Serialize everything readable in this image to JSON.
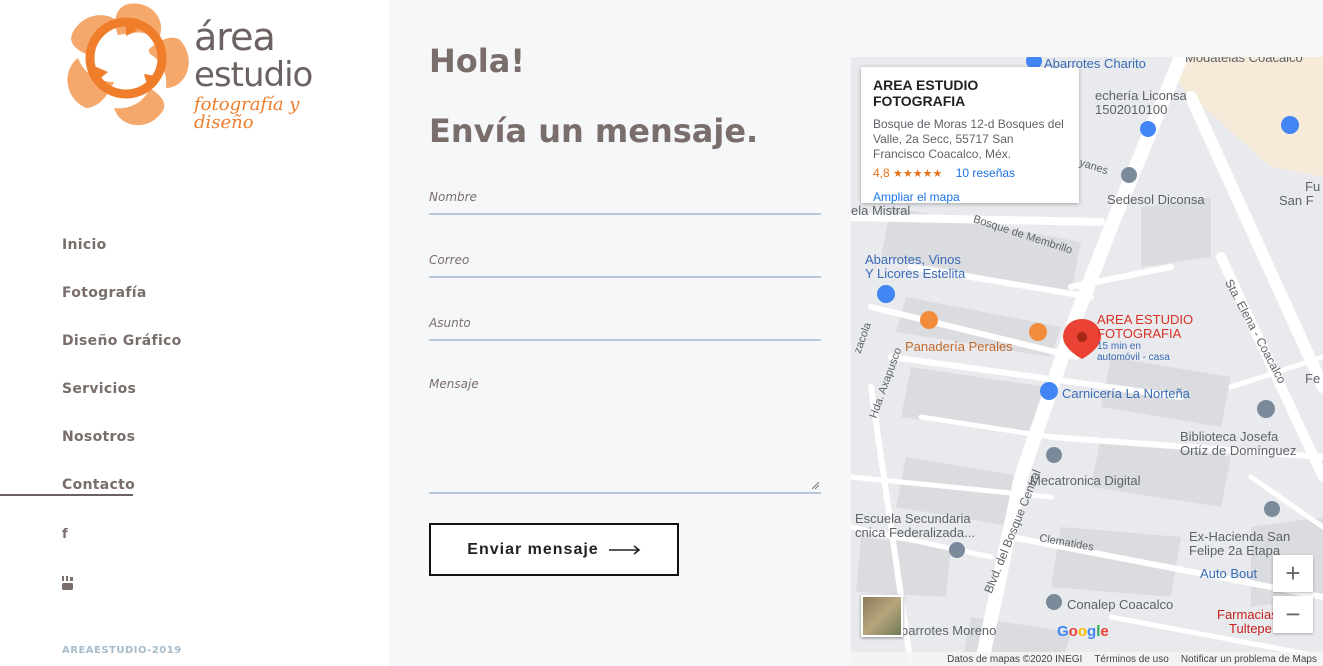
{
  "brand": {
    "word1": "área",
    "word2": "estudio",
    "tagline": "fotografía y diseño",
    "colors": {
      "orange": "#ef7d2a",
      "gray": "#6b6261"
    }
  },
  "nav": {
    "items": [
      {
        "label": "Inicio"
      },
      {
        "label": "Fotografía"
      },
      {
        "label": "Diseño Gráfico"
      },
      {
        "label": "Servicios"
      },
      {
        "label": "Nosotros"
      },
      {
        "label": "Contacto",
        "active": true
      }
    ]
  },
  "social": {
    "facebook": "f",
    "youtube_icon": "youtube-icon"
  },
  "footer": {
    "copyright": "AREAESTUDIO-2019"
  },
  "form": {
    "greeting": "Hola!",
    "heading": "Envía un mensaje.",
    "fields": {
      "name": "Nombre",
      "email": "Correo",
      "subject": "Asunto",
      "message": "Mensaje"
    },
    "submit": "Enviar mensaje"
  },
  "map": {
    "card": {
      "title": "AREA ESTUDIO FOTOGRAFIA",
      "address": "Bosque de Moras 12-d Bosques del Valle, 2a Secc, 55717 San Francisco Coacalco, Méx.",
      "rating": "4,8",
      "stars": "★★★★★",
      "reviews": "10 reseñas",
      "enlarge": "Ampliar el mapa"
    },
    "labels": {
      "abarrotes_charito": "Abarrotes Charito",
      "modatelas": "Modatelas Coacalco",
      "lecheria1": "echería Liconsa",
      "lecheria2": "1502010100",
      "ayanes": "yanes",
      "sedesol": "Sedesol Diconsa",
      "mistral": "ela Mistral",
      "membrillo": "Bosque de Membrillo",
      "abarrotes_vinos1": "Abarrotes, Vinos",
      "abarrotes_vinos2": "Y Licores Estelita",
      "panaderia": "Panadería Perales",
      "pin_name1": "AREA ESTUDIO",
      "pin_name2": "FOTOGRAFIA",
      "pin_sub1": "15 min en",
      "pin_sub2": "automóvil - casa",
      "carniceria": "Carnicería La Norteña",
      "biblioteca1": "Biblioteca Josefa",
      "biblioteca2": "Ortíz de Domínguez",
      "mecatronica": "Mecatronica Digital",
      "escuela1": "Escuela Secundaria",
      "escuela2": "cnica Federalizada...",
      "clematides": "Clematides",
      "hacienda1": "Ex-Hacienda San",
      "hacienda2": "Felipe 2a Etapa",
      "auto_bout": "Auto Bout",
      "conalep": "Conalep Coacalco",
      "farmacias1": "Farmacias",
      "farmacias2": "Tultepe",
      "abarrotes_moreno": "barrotes Moreno",
      "sta_elena": "Sta. Elena - Coacalco",
      "blvd_bosque": "Blvd. del Bosque Central",
      "axapusco": "Hda. Axapusco",
      "zacola": "zacola",
      "fe": "Fe",
      "fu": "Fu",
      "san_f": "San F"
    },
    "zoom_in": "+",
    "zoom_out": "−",
    "google": "Google",
    "footer": {
      "data": "Datos de mapas ©2020 INEGI",
      "terms": "Términos de uso",
      "report": "Notificar un problema de Maps"
    }
  }
}
